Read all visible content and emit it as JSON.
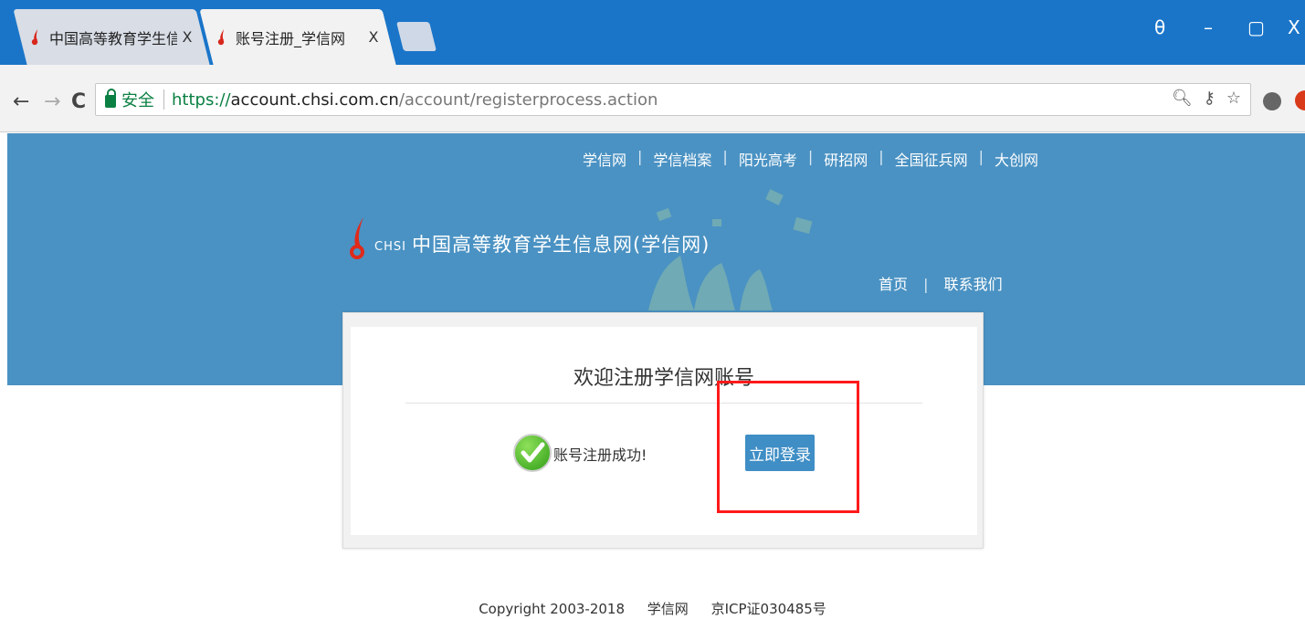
{
  "browser": {
    "tabs": [
      {
        "title": "中国高等教育学生信息网",
        "close": "X",
        "active": false
      },
      {
        "title": "账号注册_学信网",
        "close": "X",
        "active": true
      }
    ],
    "window_controls": {
      "profile": "θ",
      "minimize": "–",
      "restore": "▢",
      "close": "X"
    },
    "nav": {
      "back": "←",
      "forward": "→",
      "reload": "C"
    },
    "address": {
      "secure_label": "安全",
      "scheme": "https://",
      "host": "account.chsi.com.cn",
      "path": "/account/registerprocess.action"
    },
    "omnibox_icons": [
      "zoom-icon",
      "key-icon",
      "star-icon"
    ],
    "colors": {
      "tabbar": "#1a75c9",
      "secure": "#0b8043"
    }
  },
  "header": {
    "top_links": [
      "学信网",
      "学信档案",
      "阳光高考",
      "研招网",
      "全国征兵网",
      "大创网"
    ],
    "logo_en": "CHSI",
    "logo_text": "中国高等教育学生信息网(学信网)",
    "sub_links": [
      "首页",
      "联系我们"
    ],
    "banner_color": "#4a92c3"
  },
  "card": {
    "title": "欢迎注册学信网账号",
    "success_text": "账号注册成功!",
    "login_button": "立即登录",
    "button_color": "#3f8ec5",
    "highlight_color": "#ff1a1a"
  },
  "footer": {
    "copyright": "Copyright 2003-2018",
    "site": "学信网",
    "icp": "京ICP证030485号"
  }
}
